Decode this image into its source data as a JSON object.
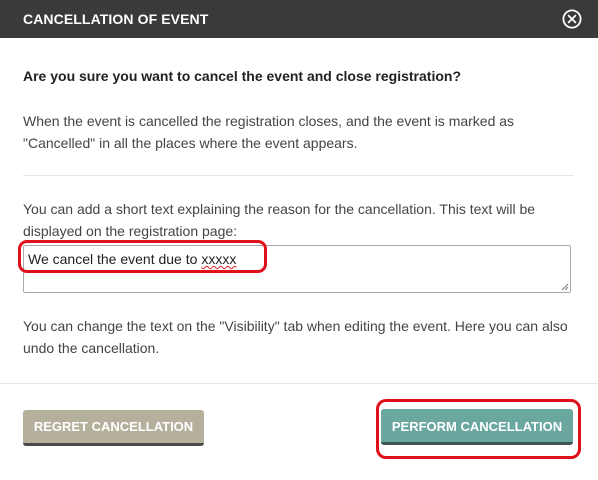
{
  "dialog": {
    "title": "CANCELLATION OF EVENT",
    "close_icon": "close-circle-icon"
  },
  "body": {
    "question": "Are you sure you want to cancel the event and close registration?",
    "info": "When the event is cancelled the registration closes, and the event is marked as \"Cancelled\" in all the places where the event appears.",
    "reason_label": "You can add a short text explaining the reason for the cancellation. This text will be displayed on the registration page:",
    "reason_input": {
      "value_prefix": "We cancel the event due to ",
      "value_misspelled": "xxxxx"
    },
    "visibility_note": "You can change the text on the \"Visibility\" tab when editing the event. Here you can also undo the cancellation."
  },
  "footer": {
    "regret_label": "REGRET CANCELLATION",
    "perform_label": "PERFORM CANCELLATION"
  },
  "colors": {
    "header_bg": "#3a3a3a",
    "regret_bg": "#b5b09c",
    "perform_bg": "#6aa79f",
    "highlight": "#e0101a"
  }
}
